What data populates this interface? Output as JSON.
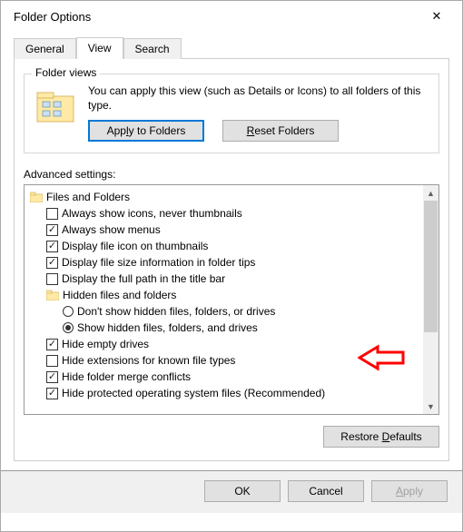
{
  "title": "Folder Options",
  "tabs": {
    "general": "General",
    "view": "View",
    "search": "Search"
  },
  "folderViews": {
    "label": "Folder views",
    "text": "You can apply this view (such as Details or Icons) to all folders of this type.",
    "applyBtn": "Apply to Folders",
    "resetBtn": "Reset Folders"
  },
  "advancedLabel": "Advanced settings:",
  "tree": {
    "root": "Files and Folders",
    "items": [
      {
        "label": "Always show icons, never thumbnails",
        "checked": false
      },
      {
        "label": "Always show menus",
        "checked": true
      },
      {
        "label": "Display file icon on thumbnails",
        "checked": true
      },
      {
        "label": "Display file size information in folder tips",
        "checked": true
      },
      {
        "label": "Display the full path in the title bar",
        "checked": false
      }
    ],
    "hiddenGroup": "Hidden files and folders",
    "radios": [
      {
        "label": "Don't show hidden files, folders, or drives",
        "checked": false
      },
      {
        "label": "Show hidden files, folders, and drives",
        "checked": true
      }
    ],
    "items2": [
      {
        "label": "Hide empty drives",
        "checked": true
      },
      {
        "label": "Hide extensions for known file types",
        "checked": false
      },
      {
        "label": "Hide folder merge conflicts",
        "checked": true
      },
      {
        "label": "Hide protected operating system files (Recommended)",
        "checked": true
      }
    ]
  },
  "restoreBtn": "Restore Defaults",
  "bottom": {
    "ok": "OK",
    "cancel": "Cancel",
    "apply": "Apply"
  }
}
